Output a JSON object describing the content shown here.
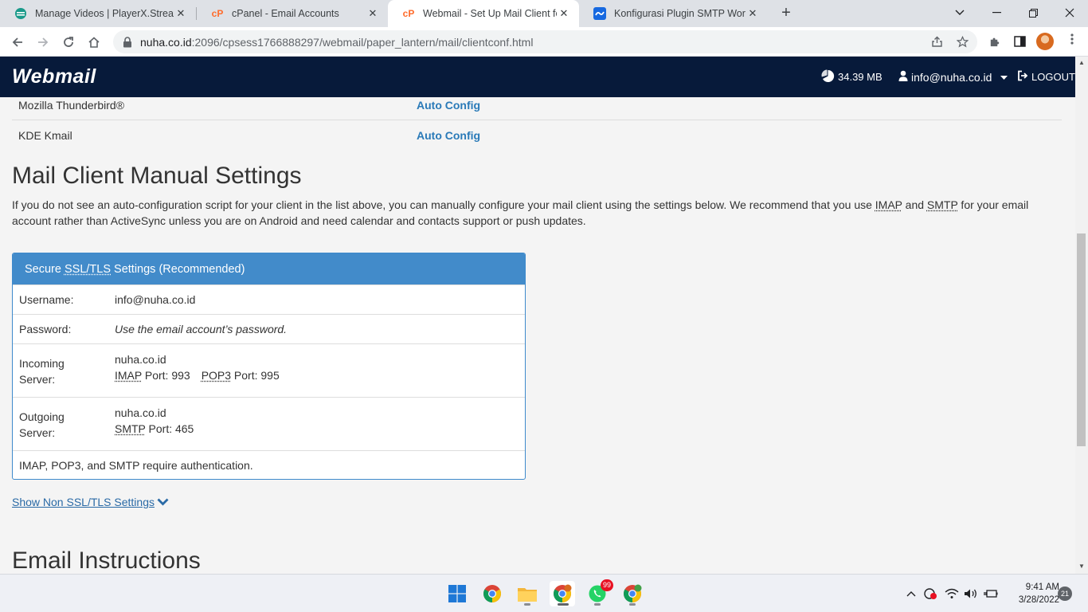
{
  "browser": {
    "tabs": [
      {
        "title": "Manage Videos | PlayerX.Stream",
        "close": "✕"
      },
      {
        "title": "cPanel - Email Accounts",
        "close": "✕"
      },
      {
        "title": "Webmail - Set Up Mail Client for",
        "close": "✕"
      },
      {
        "title": "Konfigurasi Plugin SMTP WordPre",
        "close": "✕"
      }
    ],
    "new_tab": "+",
    "url_host": "nuha.co.id",
    "url_path": ":2096/cpsess1766888297/webmail/paper_lantern/mail/clientconf.html"
  },
  "header": {
    "logo": "Webmail",
    "disk_usage": "34.39 MB",
    "user": "info@nuha.co.id",
    "logout": "LOGOUT"
  },
  "clients": [
    {
      "name": "Mozilla Thunderbird®",
      "action": "Auto Config"
    },
    {
      "name": "KDE Kmail",
      "action": "Auto Config"
    }
  ],
  "manual": {
    "title": "Mail Client Manual Settings",
    "intro_before_imap": "If you do not see an auto-configuration script for your client in the list above, you can manually configure your mail client using the settings below. We recommend that you use ",
    "imap_abbr": "IMAP",
    "and_word": " and ",
    "smtp_abbr": "SMTP",
    "intro_after": " for your email account rather than ActiveSync unless you are on Android and need calendar and contacts support or push updates."
  },
  "panel": {
    "head_prefix": "Secure ",
    "head_abbr": "SSL/TLS",
    "head_suffix": " Settings (Recommended)",
    "username_label": "Username:",
    "username_value": "info@nuha.co.id",
    "password_label": "Password:",
    "password_value": "Use the email account’s password.",
    "incoming_label_1": "Incoming",
    "incoming_label_2": "Server:",
    "incoming_host": "nuha.co.id",
    "imap_abbr": "IMAP",
    "imap_port": " Port: 993",
    "pop3_abbr": "POP3",
    "pop3_port": " Port: 995",
    "outgoing_label_1": "Outgoing",
    "outgoing_label_2": "Server:",
    "outgoing_host": "nuha.co.id",
    "smtp_abbr": "SMTP",
    "smtp_port": " Port: 465",
    "auth_note": "IMAP, POP3, and SMTP require authentication."
  },
  "toggle": {
    "label": "Show Non SSL/TLS Settings"
  },
  "next_section": {
    "title": "Email Instructions"
  },
  "taskbar": {
    "whatsapp_badge": "99",
    "time": "9:41 AM",
    "date": "3/28/2022",
    "notifications": "21"
  },
  "colors": {
    "header_bg": "#071a3a",
    "panel_head": "#428bca",
    "link": "#2a7ab8"
  }
}
